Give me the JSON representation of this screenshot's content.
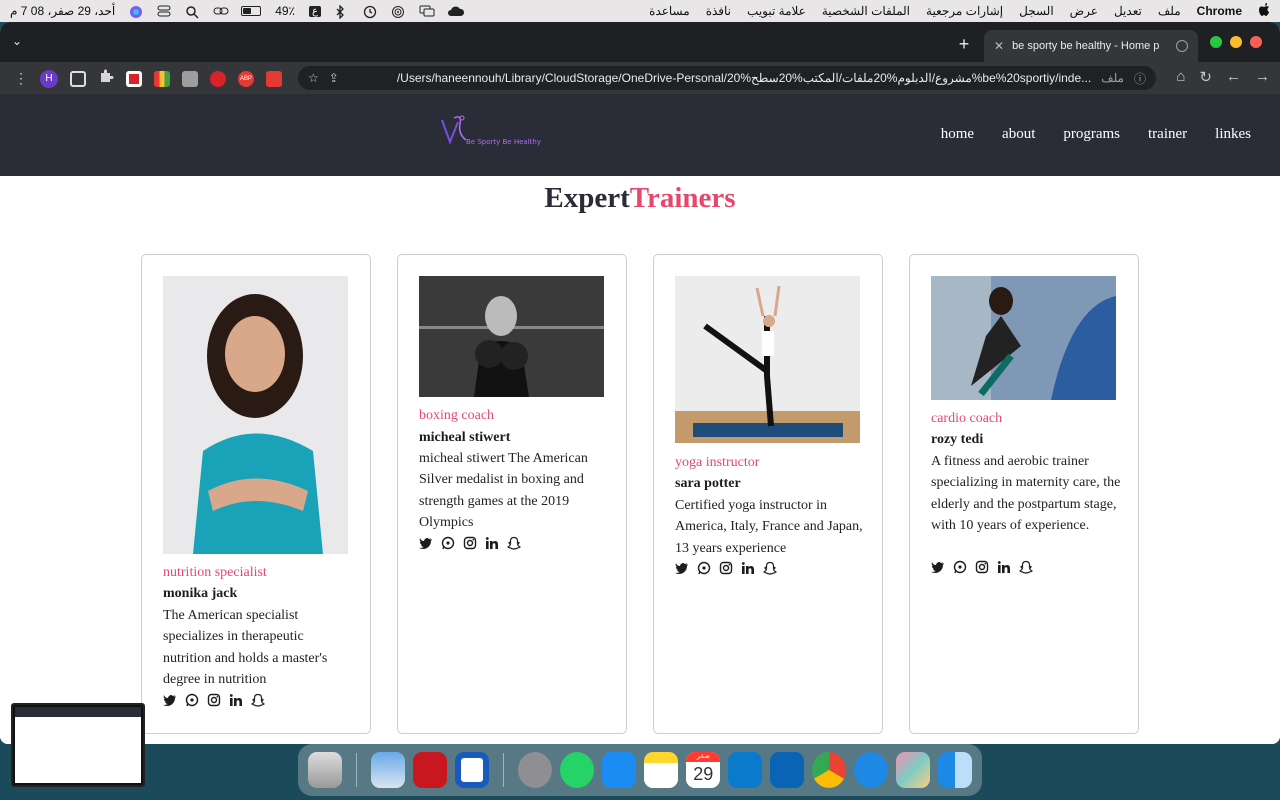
{
  "menubar": {
    "apple_label": "",
    "app_name": "Chrome",
    "menus": [
      "ملف",
      "تعديل",
      "عرض",
      "السجل",
      "إشارات مرجعية",
      "الملفات الشخصية",
      "علامة تبويب",
      "نافذة",
      "مساعدة"
    ],
    "clock": "أحد، 29 صفر، 08 7 م",
    "battery_percent": "49٪",
    "battery_level": 0.49,
    "keyboard_label": "ع"
  },
  "browser": {
    "tab_title": "be sporty be healthy - Home p",
    "url": "/Users/haneennouh/Library/CloudStorage/OneDrive-Personal/20%مشروع/الدبلوم%20ملفات/المكتب%20سطح%be%20sportiy/inde...",
    "file_label": "ملف",
    "profile_initial": "H"
  },
  "site": {
    "logo_text": "Be Sporty Be Healthy",
    "nav": [
      "home",
      "about",
      "programs",
      "trainer",
      "linkes"
    ],
    "section_title_a": "Expert",
    "section_title_b": "Trainers",
    "trainers": [
      {
        "role": "nutrition specialist",
        "name": "monika jack",
        "desc": "The American specialist specializes in therapeutic nutrition and holds a master's degree in nutrition"
      },
      {
        "role": "boxing coach",
        "name": "micheal stiwert",
        "desc": "micheal stiwert The American Silver medalist in boxing and strength games at the 2019 Olympics"
      },
      {
        "role": "yoga instructor",
        "name": "sara potter",
        "desc": "Certified yoga instructor in America, Italy, France and Japan, 13 years experience"
      },
      {
        "role": "cardio coach",
        "name": "rozy tedi",
        "desc": "A fitness and aerobic trainer specializing in maternity care, the elderly and the postpartum stage, with 10 years of experience."
      }
    ]
  },
  "dock": {
    "calendar_month": "صفر",
    "calendar_day": "29"
  },
  "colors": {
    "accent": "#e8466d",
    "header_bg": "#2a2d37"
  }
}
